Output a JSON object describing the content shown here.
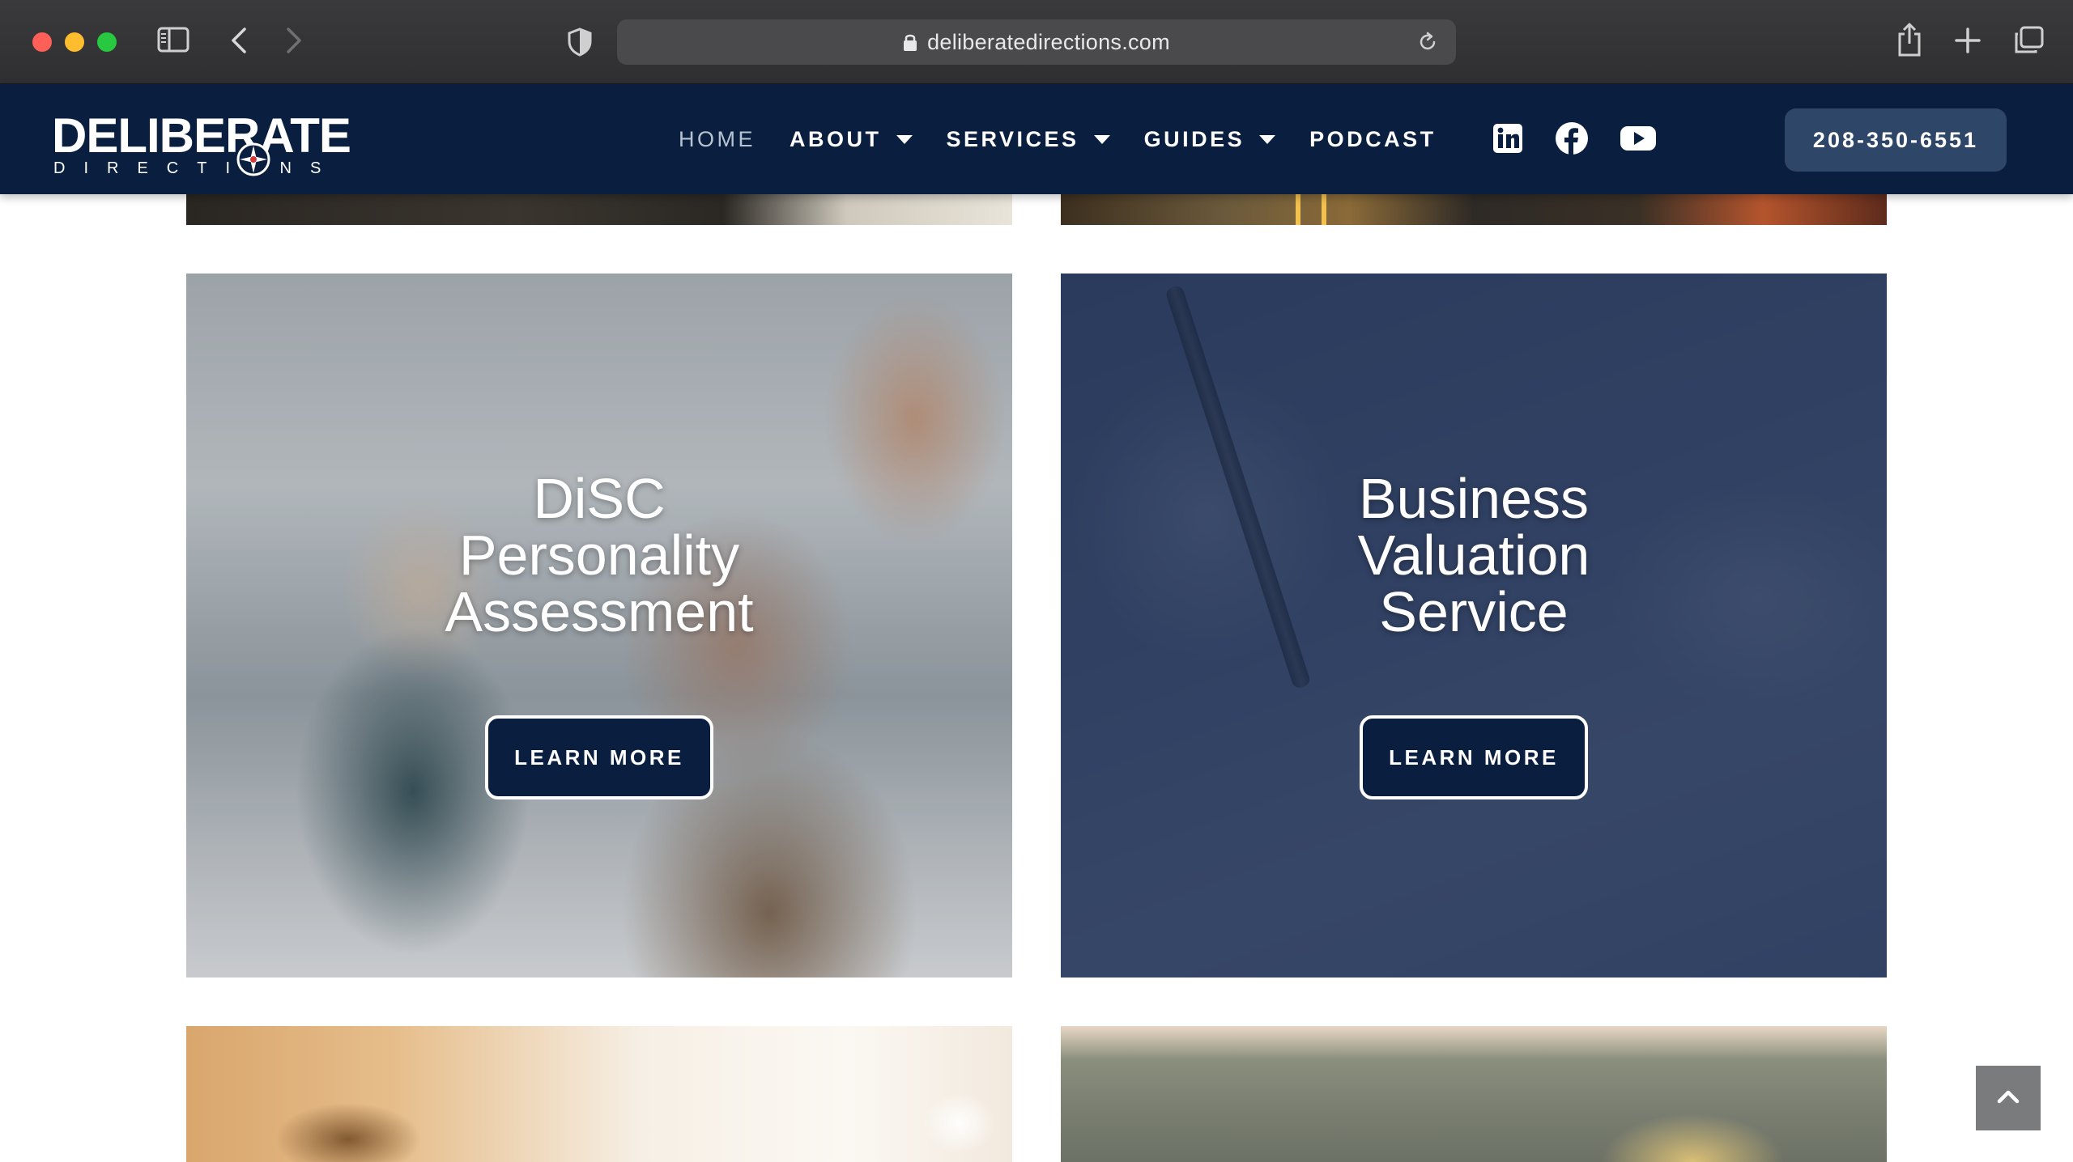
{
  "browser": {
    "url": "deliberatedirections.com",
    "icons": [
      "sidebar-icon",
      "back-icon",
      "forward-icon",
      "shield-icon",
      "lock-icon",
      "reload-icon",
      "share-icon",
      "new-tab-icon",
      "tabs-overview-icon"
    ]
  },
  "header": {
    "logo_main": "DELIBERATE",
    "logo_sub": "DIRECTIONS",
    "nav": [
      {
        "label": "HOME",
        "active": true
      },
      {
        "label": "ABOUT",
        "dropdown": true
      },
      {
        "label": "SERVICES",
        "dropdown": true
      },
      {
        "label": "GUIDES",
        "dropdown": true
      },
      {
        "label": "PODCAST"
      }
    ],
    "socials": [
      "linkedin-icon",
      "facebook-icon",
      "youtube-icon"
    ],
    "phone": "208-350-6551"
  },
  "cards": [
    {
      "title_lines": [
        "DiSC",
        "Personality",
        "Assessment"
      ],
      "button": "LEARN MORE"
    },
    {
      "title_lines": [
        "Business",
        "Valuation",
        "Service"
      ],
      "button": "LEARN MORE"
    }
  ],
  "colors": {
    "brand_navy": "#0a1f3f",
    "phone_button": "#2e4769",
    "overlay_blue": "#1e3055"
  },
  "scroll_top_icon": "chevron-up-icon"
}
